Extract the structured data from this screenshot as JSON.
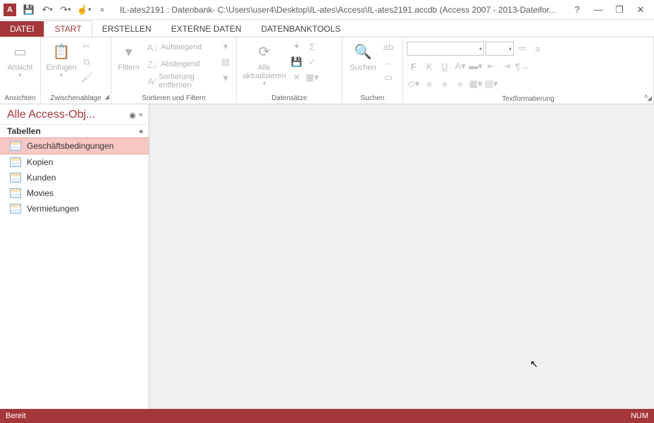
{
  "titlebar": {
    "title": "IL-ates2191 : Datenbank- C:\\Users\\user4\\Desktop\\IL-ates\\Access\\IL-ates2191.accdb (Access 2007 - 2013-Dateifor..."
  },
  "tabs": {
    "datei": "DATEI",
    "start": "START",
    "erstellen": "ERSTELLEN",
    "externe": "EXTERNE DATEN",
    "tools": "DATENBANKTOOLS"
  },
  "ribbon": {
    "ansichten": {
      "label": "Ansichten",
      "ansicht": "Ansicht"
    },
    "zwischen": {
      "label": "Zwischenablage",
      "einfuegen": "Einfügen"
    },
    "sort": {
      "label": "Sortieren und Filtern",
      "filtern": "Filtern",
      "aufsteigend": "Aufsteigend",
      "absteigend": "Absteigend",
      "entfernen": "Sortierung entfernen"
    },
    "daten": {
      "label": "Datensätze",
      "aktualisieren": "Alle aktualisieren"
    },
    "suchen": {
      "label": "Suchen",
      "suchen": "Suchen"
    },
    "textfmt": {
      "label": "Textformatierung"
    }
  },
  "nav": {
    "title": "Alle Access-Obj...",
    "section": "Tabellen",
    "items": [
      "Geschäftsbedingungen",
      "Kopien",
      "Kunden",
      "Movies",
      "Vermietungen"
    ]
  },
  "status": {
    "ready": "Bereit",
    "num": "NUM"
  }
}
